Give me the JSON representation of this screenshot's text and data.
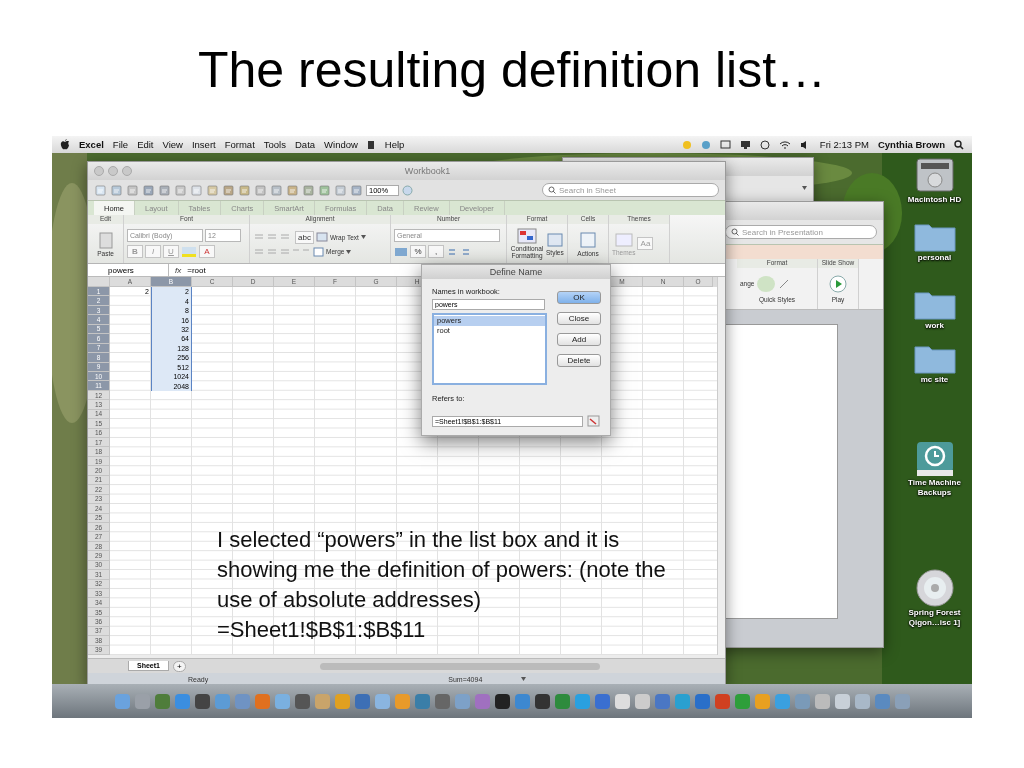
{
  "slide_title": "The resulting definition list…",
  "menu_bar": {
    "app": "Excel",
    "items": [
      "File",
      "Edit",
      "View",
      "Insert",
      "Format",
      "Tools",
      "Data",
      "Window",
      "Help"
    ],
    "clock": "Fri 2:13 PM",
    "user": "Cynthia Brown"
  },
  "excel": {
    "title": "Workbook1",
    "zoom": "100%",
    "search_placeholder": "Search in Sheet",
    "tabs": [
      {
        "label": "Home",
        "selected": true
      },
      {
        "label": "Layout",
        "selected": false
      },
      {
        "label": "Tables",
        "selected": false
      },
      {
        "label": "Charts",
        "selected": false
      },
      {
        "label": "SmartArt",
        "selected": false
      },
      {
        "label": "Formulas",
        "selected": false
      },
      {
        "label": "Data",
        "selected": false
      },
      {
        "label": "Review",
        "selected": false
      },
      {
        "label": "Developer",
        "selected": false
      }
    ],
    "groups": [
      "Edit",
      "Font",
      "Alignment",
      "Number",
      "Format",
      "Cells",
      "Themes"
    ],
    "controls": {
      "paste": "Paste",
      "font": "Calibri (Body)",
      "size": "12",
      "bold": "B",
      "italic": "I",
      "underline": "U",
      "font_color": "A",
      "abc": "abc",
      "wrap": "Wrap Text",
      "merge": "Merge",
      "number_format": "General",
      "percent": "%",
      "comma": ",",
      "conditional": "Conditional Formatting",
      "styles": "Styles",
      "actions": "Actions",
      "themes": "Themes",
      "theme_fonts": "Aa"
    },
    "name_box": "powers",
    "fx": "fx",
    "formula": "=root",
    "columns_left": [
      "A",
      "B",
      "C",
      "D",
      "E",
      "F",
      "G",
      "H"
    ],
    "columns_right": [
      "M",
      "N",
      "O"
    ],
    "rows": [
      {
        "label": "1",
        "a": "2",
        "b": "2",
        "selected": true
      },
      {
        "label": "2",
        "b": "4",
        "selected": true
      },
      {
        "label": "3",
        "b": "8",
        "selected": true
      },
      {
        "label": "4",
        "b": "16",
        "selected": true
      },
      {
        "label": "5",
        "b": "32",
        "selected": true
      },
      {
        "label": "6",
        "b": "64",
        "selected": true
      },
      {
        "label": "7",
        "b": "128",
        "selected": true
      },
      {
        "label": "8",
        "b": "256",
        "selected": true
      },
      {
        "label": "9",
        "b": "512",
        "selected": true
      },
      {
        "label": "10",
        "b": "1024",
        "selected": true
      },
      {
        "label": "11",
        "b": "2048",
        "selected": true
      },
      {
        "label": "12",
        "selected": false
      },
      {
        "label": "13",
        "selected": false
      },
      {
        "label": "14",
        "selected": false
      },
      {
        "label": "15",
        "selected": false
      },
      {
        "label": "16",
        "selected": false
      },
      {
        "label": "17",
        "selected": false
      },
      {
        "label": "18",
        "selected": false
      },
      {
        "label": "19",
        "selected": false
      },
      {
        "label": "20",
        "selected": false
      },
      {
        "label": "21",
        "selected": false
      },
      {
        "label": "22",
        "selected": false
      },
      {
        "label": "23",
        "selected": false
      },
      {
        "label": "24",
        "selected": false
      },
      {
        "label": "25",
        "selected": false
      },
      {
        "label": "26",
        "selected": false
      },
      {
        "label": "27",
        "selected": false
      },
      {
        "label": "28",
        "selected": false
      },
      {
        "label": "29",
        "selected": false
      },
      {
        "label": "30",
        "selected": false
      },
      {
        "label": "31",
        "selected": false
      },
      {
        "label": "32",
        "selected": false
      },
      {
        "label": "33",
        "selected": false
      },
      {
        "label": "34",
        "selected": false
      },
      {
        "label": "35",
        "selected": false
      },
      {
        "label": "36",
        "selected": false
      },
      {
        "label": "37",
        "selected": false
      },
      {
        "label": "38",
        "selected": false
      },
      {
        "label": "39",
        "selected": false
      }
    ],
    "sheet_tabs": [
      {
        "label": "Sheet1",
        "selected": true
      }
    ],
    "add_sheet": "+",
    "status": "Ready",
    "sum": "Sum=4094"
  },
  "dialog": {
    "title": "Define Name",
    "names_label": "Names in workbook:",
    "name_value": "powers",
    "names": [
      {
        "label": "powers",
        "selected": true
      },
      {
        "label": "root",
        "selected": false
      }
    ],
    "buttons": [
      {
        "label": "OK",
        "default": true
      },
      {
        "label": "Close",
        "default": false
      },
      {
        "label": "Add",
        "default": false
      },
      {
        "label": "Delete",
        "default": false
      }
    ],
    "refers_label": "Refers to:",
    "refers_value": "=Sheet1!$B$1:$B$11"
  },
  "powerpoint": {
    "search_placeholder": "Search in Presentation",
    "groups": [
      "Format",
      "Slide Show"
    ],
    "arrange": "ange",
    "quick_styles": "Quick Styles",
    "play": "Play"
  },
  "desktop_icons": [
    {
      "label": "Macintosh HD",
      "kind": "disk"
    },
    {
      "label": "personal",
      "kind": "folder"
    },
    {
      "label": "work",
      "kind": "folder"
    },
    {
      "label": "mc site",
      "kind": "folder"
    },
    {
      "label": "Time Machine Backups",
      "kind": "timemachine"
    },
    {
      "label": "Spring Forest Qigon…isc 1]",
      "kind": "cd"
    }
  ],
  "note": {
    "text": "I selected “powers” in the list box and it is showing me the definition of powers: (note the use of absolute addresses)",
    "formula": "=Sheet1!$B$1:$B$11"
  }
}
